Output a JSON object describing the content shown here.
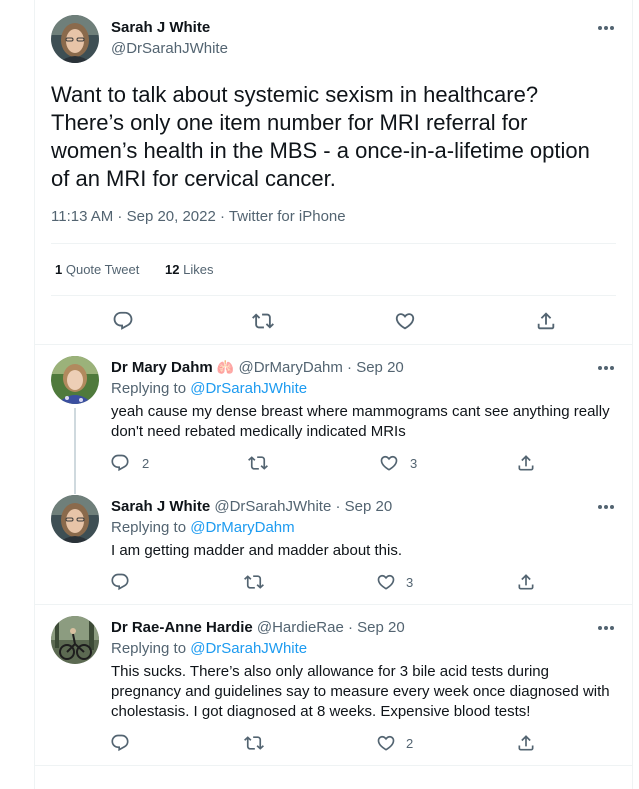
{
  "main_tweet": {
    "author_name": "Sarah J White",
    "author_handle": "@DrSarahJWhite",
    "text": "Want to talk about systemic sexism in healthcare? There’s only one item number for MRI referral for women’s health in the MBS - a once-in-a-lifetime option of an MRI for cervical cancer.",
    "meta": "11:13 AM · Sep 20, 2022 · Twitter for iPhone",
    "quote_tweets_count": "1",
    "quote_tweets_label": "Quote Tweet",
    "likes_count": "12",
    "likes_label": "Likes"
  },
  "replies": [
    {
      "author_name": "Dr Mary Dahm",
      "author_emoji": "🫁",
      "handle_time": "@DrMaryDahm · Sep 20",
      "replying_label": "Replying to",
      "replying_to": "@DrSarahJWhite",
      "text": "yeah cause my dense breast where mammograms cant see anything really don't need rebated medically indicated MRIs",
      "reply_count": "2",
      "like_count": "3"
    },
    {
      "author_name": "Sarah J White",
      "handle_time": "@DrSarahJWhite · Sep 20",
      "replying_label": "Replying to",
      "replying_to": "@DrMaryDahm",
      "text": "I am getting madder and madder about this.",
      "reply_count": "",
      "like_count": "3"
    },
    {
      "author_name": "Dr Rae-Anne Hardie",
      "handle_time": "@HardieRae · Sep 20",
      "replying_label": "Replying to",
      "replying_to": "@DrSarahJWhite",
      "text": "This sucks. There’s also only allowance for 3 bile acid tests during pregnancy and guidelines say to measure every week once diagnosed with cholestasis. I got diagnosed at 8 weeks. Expensive blood tests!",
      "reply_count": "",
      "like_count": "2"
    }
  ],
  "colors": {
    "text": "#0f1419",
    "muted": "#536471",
    "link": "#1d9bf0",
    "divider": "#eff3f4"
  },
  "icons": [
    "reply-icon",
    "retweet-icon",
    "like-icon",
    "share-icon",
    "more-icon"
  ]
}
